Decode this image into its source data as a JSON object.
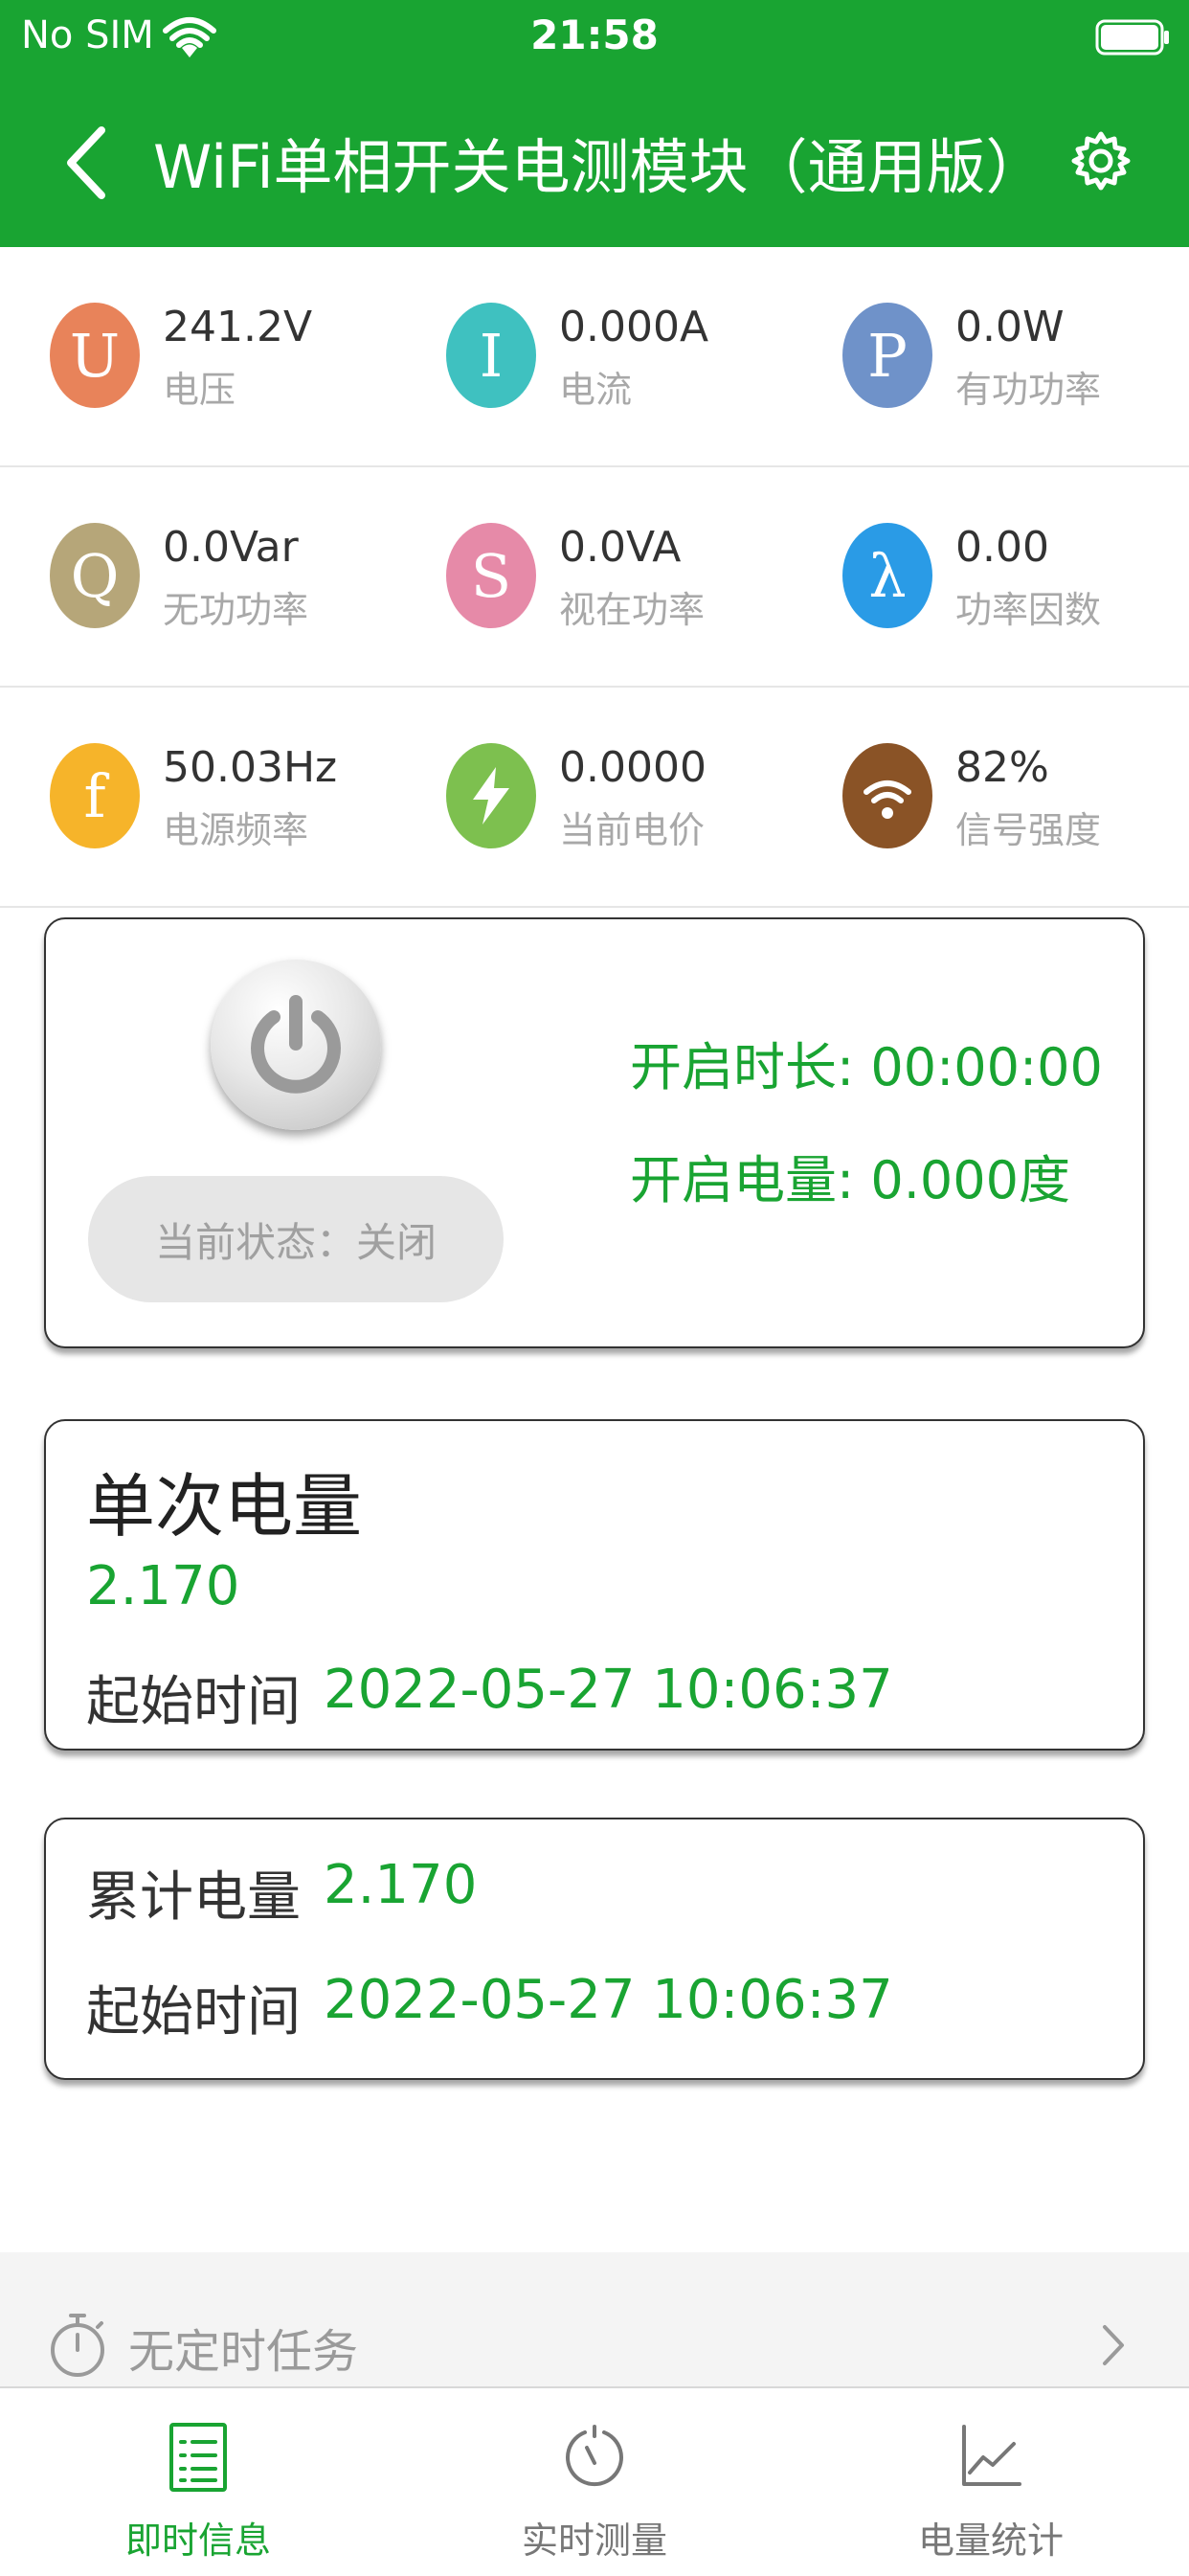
{
  "status_bar": {
    "carrier": "No SIM",
    "time": "21:58"
  },
  "nav": {
    "title": "WiFi单相开关电测模块（通用版）"
  },
  "metrics": [
    {
      "symbol": "U",
      "value": "241.2V",
      "label": "电压",
      "color": "#e8835a"
    },
    {
      "symbol": "I",
      "value": "0.000A",
      "label": "电流",
      "color": "#3fc1c0"
    },
    {
      "symbol": "P",
      "value": "0.0W",
      "label": "有功功率",
      "color": "#6f92c9"
    },
    {
      "symbol": "Q",
      "value": "0.0Var",
      "label": "无功功率",
      "color": "#b6a679"
    },
    {
      "symbol": "S",
      "value": "0.0VA",
      "label": "视在功率",
      "color": "#e68aa8"
    },
    {
      "symbol": "λ",
      "value": "0.00",
      "label": "功率因数",
      "color": "#2a9be6"
    },
    {
      "symbol": "f",
      "value": "50.03Hz",
      "label": "电源频率",
      "color": "#f6b42a"
    },
    {
      "symbol": "bolt-icon",
      "value": "0.0000",
      "label": "当前电价",
      "color": "#7dc04f"
    },
    {
      "symbol": "wifi-icon",
      "value": "82%",
      "label": "信号强度",
      "color": "#8a5326"
    }
  ],
  "power_card": {
    "state_text": "当前状态：关闭",
    "on_duration": "开启时长: 00:00:00",
    "on_energy": "开启电量: 0.000度"
  },
  "single_card": {
    "title": "单次电量",
    "value": "2.170",
    "start_label": "起始时间",
    "start_value": "2022-05-27 10:06:37"
  },
  "total_card": {
    "label": "累计电量",
    "value": "2.170",
    "start_label": "起始时间",
    "start_value": "2022-05-27 10:06:37"
  },
  "timer_bar": {
    "text": "无定时任务"
  },
  "tabs": [
    {
      "label": "即时信息",
      "active": true
    },
    {
      "label": "实时测量",
      "active": false
    },
    {
      "label": "电量统计",
      "active": false
    }
  ],
  "colors": {
    "brand_green": "#19a432"
  }
}
